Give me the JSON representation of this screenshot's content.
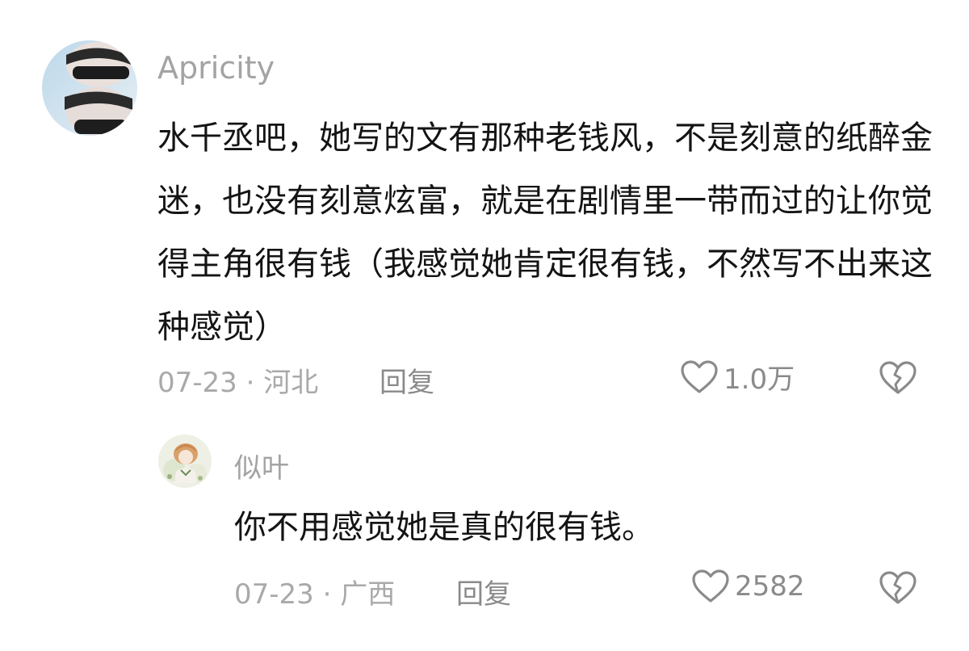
{
  "comment": {
    "username": "Apricity",
    "text": "水千丞吧，她写的文有那种老钱风，不是刻意的纸醉金迷，也没有刻意炫富，就是在剧情里一带而过的让你觉得主角很有钱（我感觉她肯定很有钱，不然写不出来这种感觉）",
    "meta": "07-23 · 河北",
    "reply_label": "回复",
    "like_count": "1.0万",
    "avatar_icon": "avatar-masked-person",
    "like_icon": "heart-outline-icon",
    "dislike_icon": "broken-heart-icon"
  },
  "reply": {
    "username": "似叶",
    "text": "你不用感觉她是真的很有钱。",
    "meta": "07-23 · 广西",
    "reply_label": "回复",
    "like_count": "2582",
    "avatar_icon": "avatar-anime-character",
    "like_icon": "heart-outline-icon",
    "dislike_icon": "broken-heart-icon"
  },
  "colors": {
    "username": "#a3a3a3",
    "text": "#141414",
    "meta": "#a9a9a9",
    "action": "#8a8a8a"
  }
}
